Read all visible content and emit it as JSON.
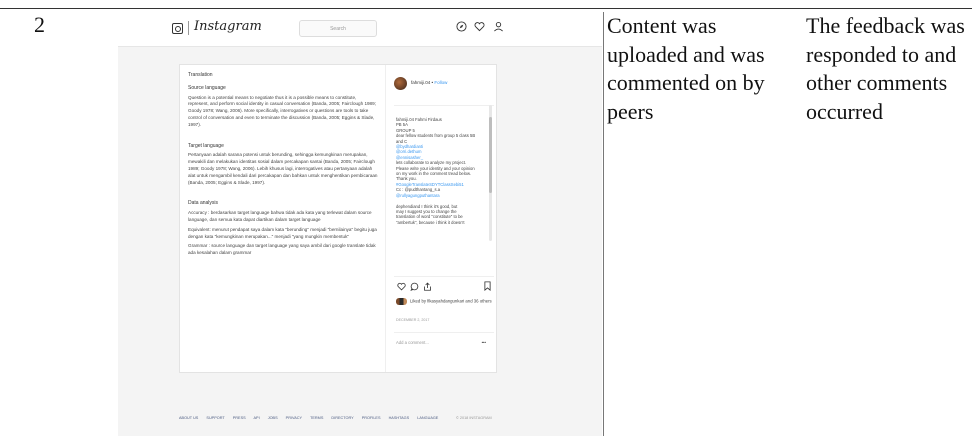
{
  "row": {
    "number": "2",
    "col3": "Content was uploaded and was commented on by peers",
    "col4": "The feedback was responded to and other comments occurred"
  },
  "instagram": {
    "logo": "Instagram",
    "search_placeholder": "Search",
    "nav_icons": [
      "compass-icon",
      "heart-icon",
      "profile-icon"
    ],
    "post": {
      "heading": "Translation",
      "source_label": "Source language",
      "source_text": "Question is a potential means to negotiate thus it is a possible means to constitute, represent, and perform social identity in casual conversation (Banda, 2005; Fairclough 1989; Goody 1978; Wang, 2006). More specifically, interrogatives or questions are tools to take control of conversation and even to terminate the discussion (Banda, 2005; Eggins & Slade, 1997).",
      "target_label": "Target language",
      "target_text": "Pertanyaan adalah sarana potensi untuk berunding, sehingga kemungkinan merupakan, mewakili dan melakukan identitas sosial dalam percakapan santai (Banda, 2005; Fairclough 1989; Goody 1978; Wang, 2006). Lebih khusus lagi, interrogatives atau pertanyaan adalah alat untuk mengambil kendali dari percakapan dan bahkan untuk menghentikan pembicaraan (Banda, 2005; Eggins & Slade, 1997).",
      "analysis_label": "Data analysis",
      "analysis": [
        "Accuracy : berdasarkan target language bahwa tidak ada kata yang terlewat dalam source language, dan semua kata dapat diartikan dalam target language",
        "Equivalent: menurut pendapat saya dalam kata \"berunding\" menjadi \"bernilainya\" begitu juga dengan kata \"kemungkinan merupakan...\" menjadi \"yang mungkin membentuk\"",
        "Grammar : source language dan target language yang saya ambil dari google translate tidak ada kesalahan dalam grammar"
      ]
    },
    "sidebar": {
      "username": "fahmiji.04",
      "follow": "Follow",
      "caption_lines": [
        "fahmiji.04 Fahmi Firdaus",
        "PB 5A",
        "GROUP 5",
        "dear fellow students from group 5 class 5B",
        "and C",
        "@bydhardianti",
        "@orri.dethum",
        "@ennisasher_",
        "lets collaborate to analyze my project.",
        "Please write your identity and your opinion",
        "on my work in the comment tread below.",
        "Thank you.",
        "#GoogleTranslateSDYTClassSebi51",
        "Cc : @pudthantang_s.a",
        "@rullyagungputhantara",
        "",
        "dephendiand I think it's good, but",
        "may I suggest you to change the",
        "translation of word \"constitute\" to be",
        "\"ambertuk\", because i think it doesn't"
      ],
      "likes_text": "Liked by fikasyahdangunkari and 36 others",
      "date": "DECEMBER 2, 2017",
      "add_comment": "Add a comment...",
      "more": "•••"
    },
    "footer_links": [
      "ABOUT US",
      "SUPPORT",
      "PRESS",
      "API",
      "JOBS",
      "PRIVACY",
      "TERMS",
      "DIRECTORY",
      "PROFILES",
      "HASHTAGS",
      "LANGUAGE"
    ],
    "copyright": "© 2018 INSTAGRAM"
  }
}
